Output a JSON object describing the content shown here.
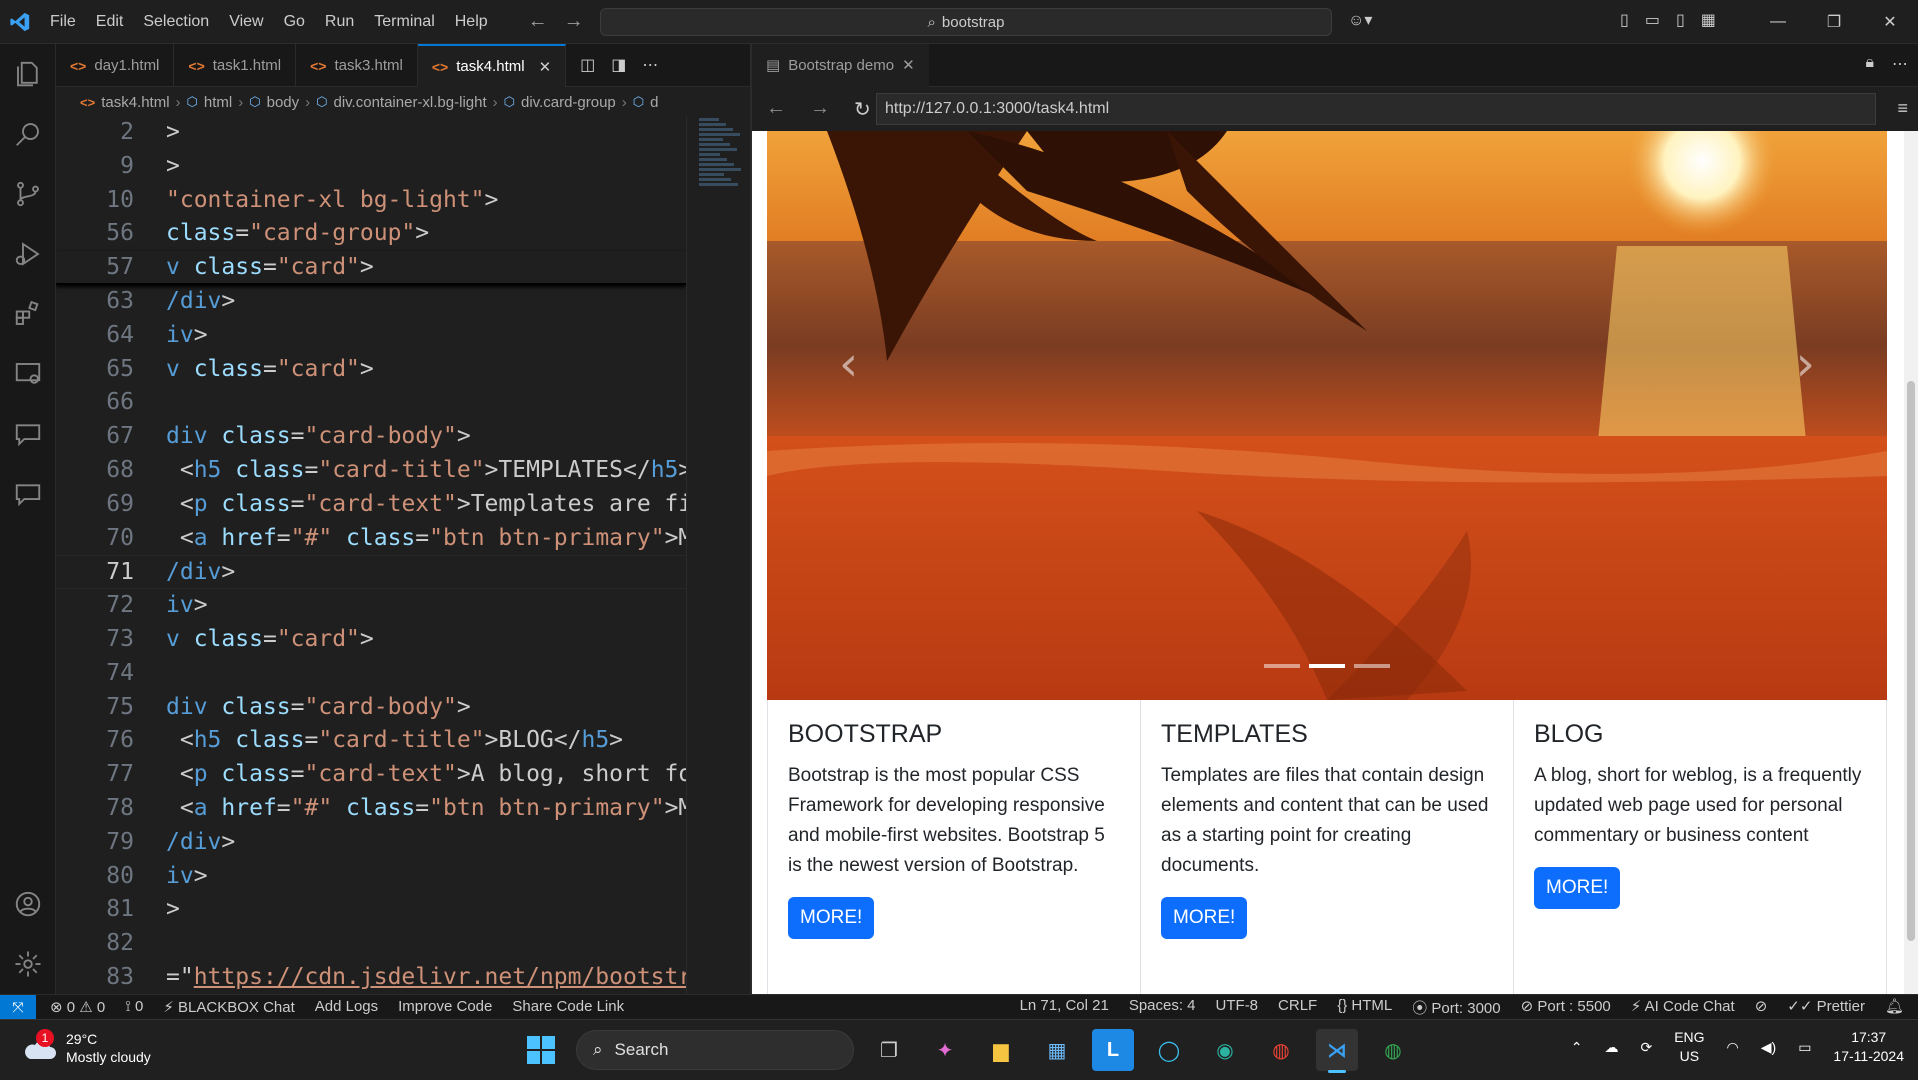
{
  "titlebar": {
    "menu": [
      "File",
      "Edit",
      "Selection",
      "View",
      "Go",
      "Run",
      "Terminal",
      "Help"
    ],
    "search_text": "bootstrap"
  },
  "editor": {
    "tabs": [
      {
        "label": "day1.html",
        "active": false
      },
      {
        "label": "task1.html",
        "active": false
      },
      {
        "label": "task3.html",
        "active": false
      },
      {
        "label": "task4.html",
        "active": true
      }
    ],
    "breadcrumb": [
      "task4.html",
      "html",
      "body",
      "div.container-xl.bg-light",
      "div.card-group",
      "d"
    ],
    "lines": [
      {
        "n": "2",
        "parts": [
          [
            "t-plain",
            ">"
          ]
        ]
      },
      {
        "n": "9",
        "parts": [
          [
            "t-plain",
            ">"
          ]
        ]
      },
      {
        "n": "10",
        "parts": [
          [
            "t-str",
            "\"container-xl bg-light\""
          ],
          [
            "t-plain",
            ">"
          ]
        ]
      },
      {
        "n": "56",
        "parts": [
          [
            "t-attr",
            "class"
          ],
          [
            "t-plain",
            "="
          ],
          [
            "t-str",
            "\"card-group\""
          ],
          [
            "t-plain",
            ">"
          ]
        ]
      },
      {
        "n": "57",
        "parts": [
          [
            "t-tag",
            "v "
          ],
          [
            "t-attr",
            "class"
          ],
          [
            "t-plain",
            "="
          ],
          [
            "t-str",
            "\"card\""
          ],
          [
            "t-plain",
            ">"
          ]
        ]
      },
      {
        "n": "63",
        "parts": [
          [
            "t-tag",
            "/div"
          ],
          [
            "t-plain",
            ">"
          ]
        ]
      },
      {
        "n": "64",
        "parts": [
          [
            "t-tag",
            "iv"
          ],
          [
            "t-plain",
            ">"
          ]
        ]
      },
      {
        "n": "65",
        "parts": [
          [
            "t-tag",
            "v "
          ],
          [
            "t-attr",
            "class"
          ],
          [
            "t-plain",
            "="
          ],
          [
            "t-str",
            "\"card\""
          ],
          [
            "t-plain",
            ">"
          ]
        ]
      },
      {
        "n": "66",
        "parts": []
      },
      {
        "n": "67",
        "parts": [
          [
            "t-tag",
            "div "
          ],
          [
            "t-attr",
            "class"
          ],
          [
            "t-plain",
            "="
          ],
          [
            "t-str",
            "\"card-body\""
          ],
          [
            "t-plain",
            ">"
          ]
        ]
      },
      {
        "n": "68",
        "parts": [
          [
            "t-plain",
            " <"
          ],
          [
            "t-tag",
            "h5 "
          ],
          [
            "t-attr",
            "class"
          ],
          [
            "t-plain",
            "="
          ],
          [
            "t-str",
            "\"card-title\""
          ],
          [
            "t-plain",
            ">TEMPLATES</"
          ],
          [
            "t-tag",
            "h5"
          ],
          [
            "t-plain",
            ">"
          ]
        ]
      },
      {
        "n": "69",
        "parts": [
          [
            "t-plain",
            " <"
          ],
          [
            "t-tag",
            "p "
          ],
          [
            "t-attr",
            "class"
          ],
          [
            "t-plain",
            "="
          ],
          [
            "t-str",
            "\"card-text\""
          ],
          [
            "t-plain",
            ">Templates are fi"
          ]
        ]
      },
      {
        "n": "70",
        "parts": [
          [
            "t-plain",
            " <"
          ],
          [
            "t-tag",
            "a "
          ],
          [
            "t-attr",
            "href"
          ],
          [
            "t-plain",
            "="
          ],
          [
            "t-str",
            "\"#\" "
          ],
          [
            "t-attr",
            "class"
          ],
          [
            "t-plain",
            "="
          ],
          [
            "t-str",
            "\"btn btn-primary\""
          ],
          [
            "t-plain",
            ">M("
          ]
        ]
      },
      {
        "n": "71",
        "parts": [
          [
            "t-tag",
            "/div"
          ],
          [
            "t-plain",
            ">"
          ]
        ]
      },
      {
        "n": "72",
        "parts": [
          [
            "t-tag",
            "iv"
          ],
          [
            "t-plain",
            ">"
          ]
        ]
      },
      {
        "n": "73",
        "parts": [
          [
            "t-tag",
            "v "
          ],
          [
            "t-attr",
            "class"
          ],
          [
            "t-plain",
            "="
          ],
          [
            "t-str",
            "\"card\""
          ],
          [
            "t-plain",
            ">"
          ]
        ]
      },
      {
        "n": "74",
        "parts": []
      },
      {
        "n": "75",
        "parts": [
          [
            "t-tag",
            "div "
          ],
          [
            "t-attr",
            "class"
          ],
          [
            "t-plain",
            "="
          ],
          [
            "t-str",
            "\"card-body\""
          ],
          [
            "t-plain",
            ">"
          ]
        ]
      },
      {
        "n": "76",
        "parts": [
          [
            "t-plain",
            " <"
          ],
          [
            "t-tag",
            "h5 "
          ],
          [
            "t-attr",
            "class"
          ],
          [
            "t-plain",
            "="
          ],
          [
            "t-str",
            "\"card-title\""
          ],
          [
            "t-plain",
            ">BLOG</"
          ],
          [
            "t-tag",
            "h5"
          ],
          [
            "t-plain",
            ">"
          ]
        ]
      },
      {
        "n": "77",
        "parts": [
          [
            "t-plain",
            " <"
          ],
          [
            "t-tag",
            "p "
          ],
          [
            "t-attr",
            "class"
          ],
          [
            "t-plain",
            "="
          ],
          [
            "t-str",
            "\"card-text\""
          ],
          [
            "t-plain",
            ">A blog, short fo"
          ]
        ]
      },
      {
        "n": "78",
        "parts": [
          [
            "t-plain",
            " <"
          ],
          [
            "t-tag",
            "a "
          ],
          [
            "t-attr",
            "href"
          ],
          [
            "t-plain",
            "="
          ],
          [
            "t-str",
            "\"#\" "
          ],
          [
            "t-attr",
            "class"
          ],
          [
            "t-plain",
            "="
          ],
          [
            "t-str",
            "\"btn btn-primary\""
          ],
          [
            "t-plain",
            ">M("
          ]
        ]
      },
      {
        "n": "79",
        "parts": [
          [
            "t-tag",
            "/div"
          ],
          [
            "t-plain",
            ">"
          ]
        ]
      },
      {
        "n": "80",
        "parts": [
          [
            "t-tag",
            "iv"
          ],
          [
            "t-plain",
            ">"
          ]
        ]
      },
      {
        "n": "81",
        "parts": [
          [
            "t-plain",
            ">"
          ]
        ]
      },
      {
        "n": "82",
        "parts": []
      },
      {
        "n": "83",
        "parts": [
          [
            "t-plain",
            "=\""
          ],
          [
            "t-url",
            "https://cdn.jsdelivr.net/npm/bootstr"
          ]
        ]
      }
    ],
    "current_line": "71"
  },
  "browser": {
    "tab_label": "Bootstrap demo",
    "url": "http://127.0.0.1:3000/task4.html",
    "carousel": {
      "prev": "‹",
      "next": "›",
      "active_index": 1,
      "count": 3
    },
    "cards": [
      {
        "title": "BOOTSTRAP",
        "text": "Bootstrap is the most popular CSS Framework for developing responsive and mobile-first websites. Bootstrap 5 is the newest version of Bootstrap.",
        "button": "MORE!"
      },
      {
        "title": "TEMPLATES",
        "text": "Templates are files that contain design elements and content that can be used as a starting point for creating documents.",
        "button": "MORE!"
      },
      {
        "title": "BLOG",
        "text": "A blog, short for weblog, is a frequently updated web page used for personal commentary or business content",
        "button": "MORE!"
      }
    ]
  },
  "statusbar": {
    "errors": "0",
    "warnings": "0",
    "ports_count": "0",
    "blackbox": "BLACKBOX Chat",
    "add_logs": "Add Logs",
    "improve_code": "Improve Code",
    "share_link": "Share Code Link",
    "position": "Ln 71, Col 21",
    "spaces": "Spaces: 4",
    "encoding": "UTF-8",
    "eol": "CRLF",
    "language": "HTML",
    "port_server": "Port: 3000",
    "port_live": "Port : 5500",
    "ai_chat": "AI Code Chat",
    "prettier": "Prettier"
  },
  "taskbar": {
    "temperature": "29°C",
    "weather": "Mostly cloudy",
    "weather_badge": "1",
    "search_label": "Search",
    "lang_top": "ENG",
    "lang_bottom": "US",
    "time": "17:37",
    "date": "17-11-2024"
  }
}
